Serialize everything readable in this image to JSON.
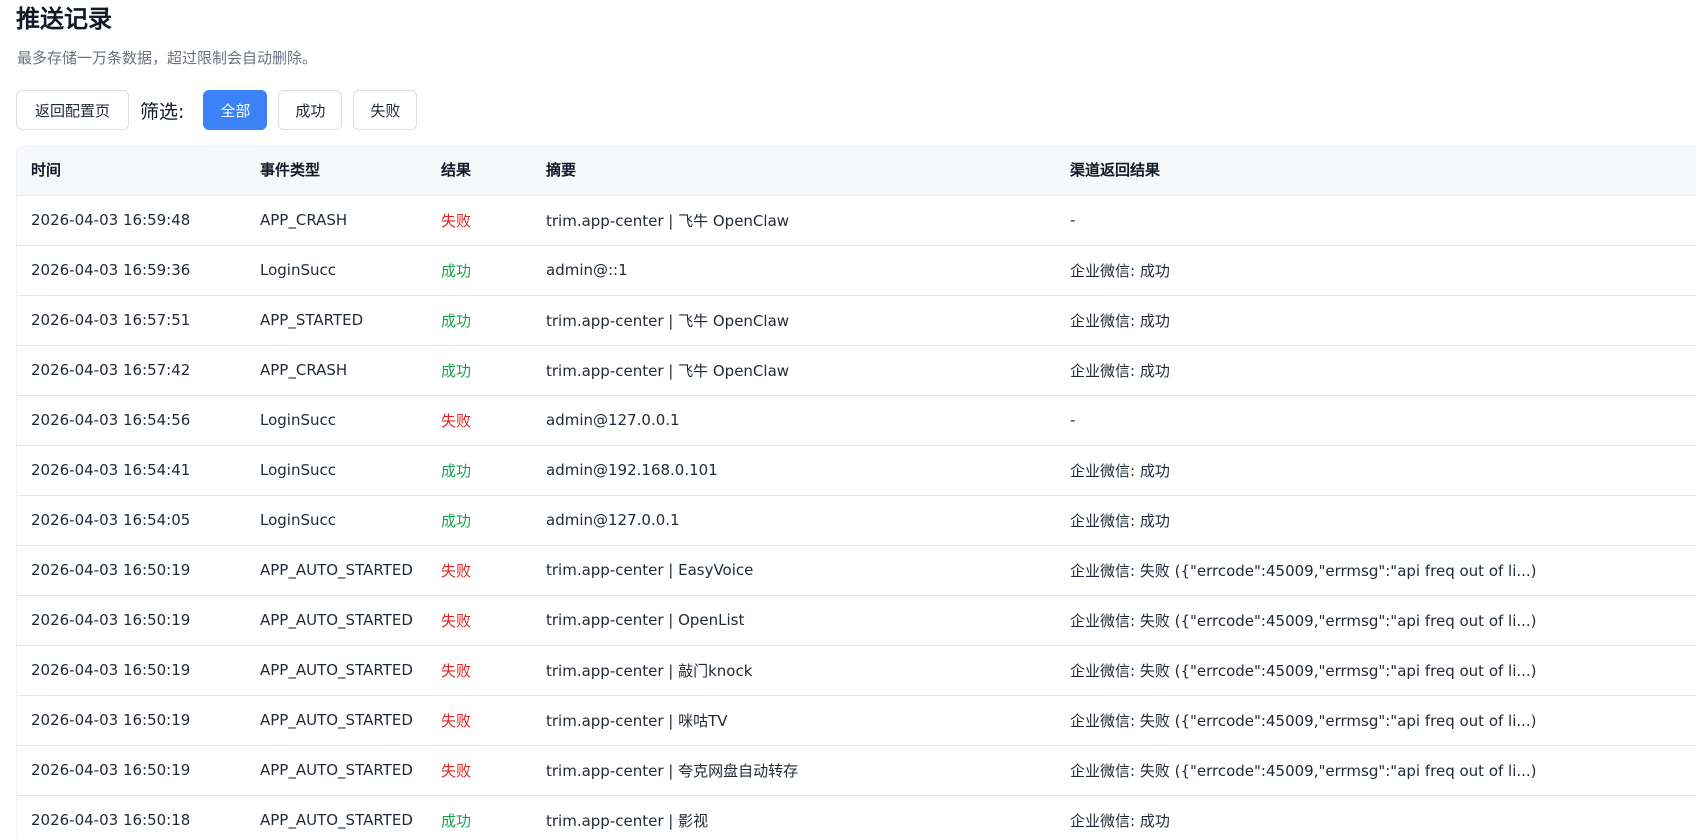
{
  "header": {
    "title": "推送记录",
    "subtitle": "最多存储一万条数据，超过限制会自动删除。"
  },
  "toolbar": {
    "back_label": "返回配置页",
    "filter_label": "筛选:",
    "filters": [
      "全部",
      "成功",
      "失败"
    ],
    "active_filter": "全部"
  },
  "colors": {
    "accent": "#3b82f6",
    "success": "#16a34a",
    "failure": "#dc2626"
  },
  "table": {
    "columns": [
      "时间",
      "事件类型",
      "结果",
      "摘要",
      "渠道返回结果"
    ],
    "rows": [
      {
        "time": "2026-04-03 16:59:48",
        "event": "APP_CRASH",
        "result": "失败",
        "status": "fail",
        "summary": "trim.app-center | 飞牛 OpenClaw",
        "channel": "-"
      },
      {
        "time": "2026-04-03 16:59:36",
        "event": "LoginSucc",
        "result": "成功",
        "status": "ok",
        "summary": "admin@::1",
        "channel": "企业微信: 成功"
      },
      {
        "time": "2026-04-03 16:57:51",
        "event": "APP_STARTED",
        "result": "成功",
        "status": "ok",
        "summary": "trim.app-center | 飞牛 OpenClaw",
        "channel": "企业微信: 成功"
      },
      {
        "time": "2026-04-03 16:57:42",
        "event": "APP_CRASH",
        "result": "成功",
        "status": "ok",
        "summary": "trim.app-center | 飞牛 OpenClaw",
        "channel": "企业微信: 成功"
      },
      {
        "time": "2026-04-03 16:54:56",
        "event": "LoginSucc",
        "result": "失败",
        "status": "fail",
        "summary": "admin@127.0.0.1",
        "channel": "-"
      },
      {
        "time": "2026-04-03 16:54:41",
        "event": "LoginSucc",
        "result": "成功",
        "status": "ok",
        "summary": "admin@192.168.0.101",
        "channel": "企业微信: 成功"
      },
      {
        "time": "2026-04-03 16:54:05",
        "event": "LoginSucc",
        "result": "成功",
        "status": "ok",
        "summary": "admin@127.0.0.1",
        "channel": "企业微信: 成功"
      },
      {
        "time": "2026-04-03 16:50:19",
        "event": "APP_AUTO_STARTED",
        "result": "失败",
        "status": "fail",
        "summary": "trim.app-center | EasyVoice",
        "channel": "企业微信: 失败 ({\"errcode\":45009,\"errmsg\":\"api freq out of li...)"
      },
      {
        "time": "2026-04-03 16:50:19",
        "event": "APP_AUTO_STARTED",
        "result": "失败",
        "status": "fail",
        "summary": "trim.app-center | OpenList",
        "channel": "企业微信: 失败 ({\"errcode\":45009,\"errmsg\":\"api freq out of li...)"
      },
      {
        "time": "2026-04-03 16:50:19",
        "event": "APP_AUTO_STARTED",
        "result": "失败",
        "status": "fail",
        "summary": "trim.app-center | 敲门knock",
        "channel": "企业微信: 失败 ({\"errcode\":45009,\"errmsg\":\"api freq out of li...)"
      },
      {
        "time": "2026-04-03 16:50:19",
        "event": "APP_AUTO_STARTED",
        "result": "失败",
        "status": "fail",
        "summary": "trim.app-center | 咪咕TV",
        "channel": "企业微信: 失败 ({\"errcode\":45009,\"errmsg\":\"api freq out of li...)"
      },
      {
        "time": "2026-04-03 16:50:19",
        "event": "APP_AUTO_STARTED",
        "result": "失败",
        "status": "fail",
        "summary": "trim.app-center | 夸克网盘自动转存",
        "channel": "企业微信: 失败 ({\"errcode\":45009,\"errmsg\":\"api freq out of li...)"
      },
      {
        "time": "2026-04-03 16:50:18",
        "event": "APP_AUTO_STARTED",
        "result": "成功",
        "status": "ok",
        "summary": "trim.app-center | 影视",
        "channel": "企业微信: 成功"
      }
    ]
  }
}
